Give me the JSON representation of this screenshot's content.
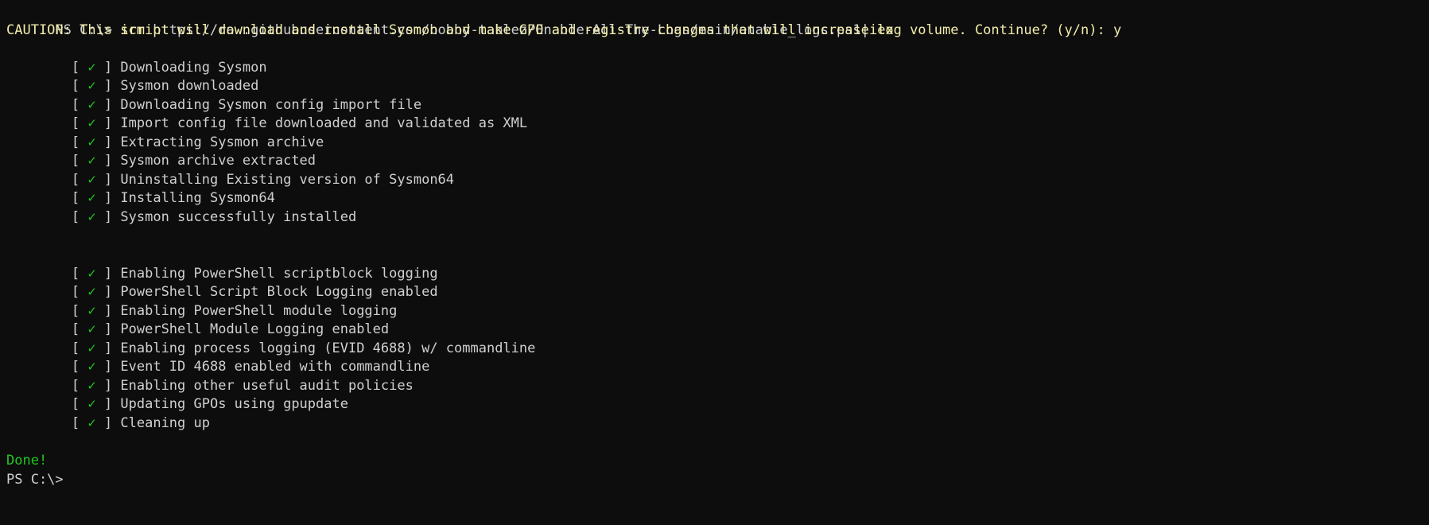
{
  "terminal": {
    "shell": "PowerShell",
    "background_color": "#0d0d0d",
    "default_text_color": "#cfd0d0",
    "accent_colors": {
      "cmdlet_yellow": "#f2edaa",
      "success_green": "#1ec81e",
      "plain_white": "#cfd0d0"
    },
    "prompt": "PS C:\\>",
    "check_open_bracket": "[",
    "check_glyph": "✓",
    "check_close_bracket": "]"
  },
  "command_line": {
    "prompt": "PS C:\\> ",
    "cmdlet": "irm",
    "space": " ",
    "url": "https://raw.githubusercontent.com/bobby-tablez/Enable-All-The-Logs/main/enable_logs.ps1",
    "pipe": "|",
    "pipe_cmdlet": "iex"
  },
  "caution_line": "CAUTION: This script will download and install Sysmon and make GPO and registry changes that will increase log volume. Continue? (y/n): y",
  "status_group_1": [
    "Downloading Sysmon",
    "Sysmon downloaded",
    "Downloading Sysmon config import file",
    "Import config file downloaded and validated as XML",
    "Extracting Sysmon archive",
    "Sysmon archive extracted",
    "Uninstalling Existing version of Sysmon64",
    "Installing Sysmon64",
    "Sysmon successfully installed"
  ],
  "status_group_2": [
    "Enabling PowerShell scriptblock logging",
    "PowerShell Script Block Logging enabled",
    "Enabling PowerShell module logging",
    "PowerShell Module Logging enabled",
    "Enabling process logging (EVID 4688) w/ commandline",
    "Event ID 4688 enabled with commandline",
    "Enabling other useful audit policies",
    "Updating GPOs using gpupdate",
    "Cleaning up"
  ],
  "done_line": "Done!",
  "final_prompt": "PS C:\\>"
}
